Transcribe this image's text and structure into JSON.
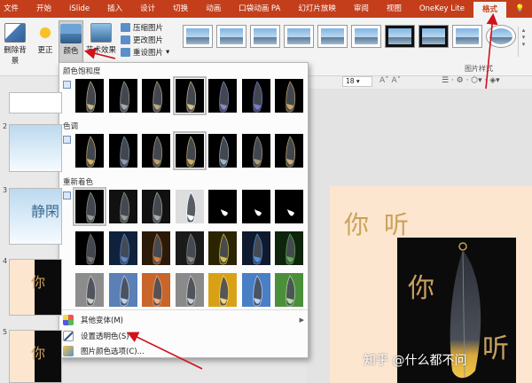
{
  "ribbon_tabs": [
    "文件",
    "开始",
    "iSlide",
    "插入",
    "设计",
    "切换",
    "动画",
    "口袋动画 PA",
    "幻灯片放映",
    "审阅",
    "视图",
    "OneKey Lite",
    "格式"
  ],
  "active_tab": "格式",
  "ribbon": {
    "remove_bg": "删除背景",
    "corrections": "更正",
    "color": "颜色",
    "artistic": "艺术效果",
    "compress": "压缩图片",
    "change": "更改图片",
    "reset": "重设图片",
    "styles_group": "图片样式",
    "font_size": "18"
  },
  "dropdown": {
    "saturation_title": "颜色饱和度",
    "tone_title": "色调",
    "recolor_title": "重新着色",
    "more_variants": "其他变体(M)",
    "set_transparent": "设置透明色(S)",
    "color_options": "图片颜色选项(C)..."
  },
  "slides": [
    {
      "num": "2",
      "text": ""
    },
    {
      "num": "3",
      "text": "静閑"
    },
    {
      "num": "4",
      "text": "你"
    },
    {
      "num": "5",
      "text": "你"
    }
  ],
  "slide_main": {
    "title": "你 听",
    "img_char1": "你",
    "img_char2": "听"
  },
  "watermark": "知乎 @什么都不问",
  "colors": {
    "accent": "#c43e1c",
    "arrow": "#d0121b"
  }
}
